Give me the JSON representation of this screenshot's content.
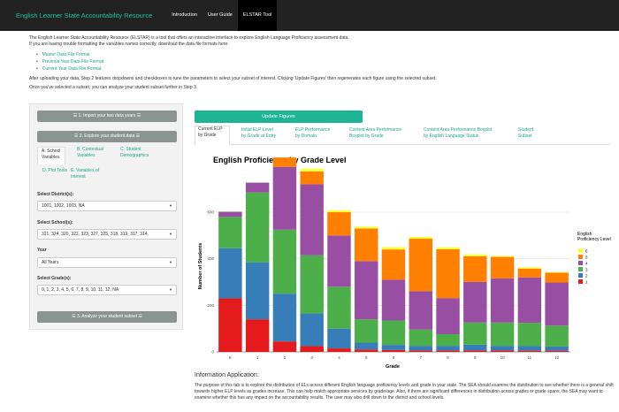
{
  "navbar": {
    "brand": "English Learner State Accountability Resource",
    "items": [
      "Introduction",
      "User Guide",
      "ELSTAR Tool"
    ],
    "active_index": 2
  },
  "intro": {
    "line1": "The English Learner State Accountability Resource (ELSTAR) is a tool that offers an interactive interface to explore English Language Proficiency assessment data.",
    "line2": "If you are having trouble formatting the variables names correctly, download the data file formats here:",
    "links": [
      "Master Data File Format",
      "Previous Year Data File Format",
      "Current Year Data File Format"
    ],
    "line3": "After uploading your data, Step 2 features dropdowns and checkboxes to tune the parameters to select your subset of interest. Clicking 'Update Figures' then regenerates each figure using the selected subset.",
    "line4": "Once you've selected a subset, you can analyze your student subset further in Step 3."
  },
  "sidebar": {
    "step1": "☰ 1. Import your two data years ☰",
    "step2": "☰ 2. Explore your student data ☰",
    "subtabs": [
      "A. School Variables",
      "B. Contextual Variables",
      "C. Student Demographics",
      "D. Plot Tools",
      "E. Variables of Interest"
    ],
    "district_label": "Select District(s):",
    "district_value": "1001, 1002, 1003, NA",
    "school_label": "Select School(s):",
    "school_value": "321, 324, 320, 322, 323, 327, 325, 318, 319, 317, 314,",
    "year_label": "Year",
    "year_value": "All Years",
    "grade_label": "Select Grade(s):",
    "grade_value": "0, 1, 2, 3, 4, 5, 6, 7, 8, 9, 10, 11, 12, NA",
    "step3": "☰ 3. Analyze your student subset ☰"
  },
  "main": {
    "update_button": "Update Figures",
    "tabs": [
      {
        "l1": "Current ELP",
        "l2": "by Grade"
      },
      {
        "l1": "Initial ELP Level",
        "l2": "by Grade at Entry"
      },
      {
        "l1": "ELP Performance",
        "l2": "by Domain"
      },
      {
        "l1": "Content Area Performance",
        "l2": "Boxplot by Grade"
      },
      {
        "l1": "Content Area Performance Boxplot",
        "l2": "by English Language Status"
      },
      {
        "l1": "Student",
        "l2": "Subset"
      }
    ],
    "info_title": "Information Application:",
    "info_text": "The purpose of this tab is to explore the distribution of ELs across different English language proficiency levels and grade in your state. The SEA should examine the distribution to see whether there is a general shift towards higher ELP levels as grades increase. This can help match appropriate services by grade/age. Also, if there are significant differences in distribution across grades or grade spans, the SEA may want to examine whether this has any impact on the accountability results. The user may also drill down to the district and school levels."
  },
  "chart_data": {
    "type": "bar",
    "stacked": true,
    "title": "English Proficiency by Grade Level",
    "xlabel": "Grade",
    "ylabel": "Number of Students",
    "legend_title": "English Proficiency Level",
    "legend_position": "right",
    "categories": [
      "K",
      "1",
      "2",
      "3",
      "4",
      "5",
      "6",
      "7",
      "8",
      "9",
      "10",
      "11",
      "12"
    ],
    "yticks": [
      0,
      200,
      400,
      600
    ],
    "ylim": [
      0,
      790
    ],
    "grid": true,
    "series": [
      {
        "name": "1",
        "color": "#e41a1c",
        "values": [
          230,
          140,
          45,
          25,
          15,
          10,
          8,
          6,
          6,
          6,
          6,
          5,
          5
        ]
      },
      {
        "name": "2",
        "color": "#377eb8",
        "values": [
          215,
          245,
          205,
          140,
          85,
          30,
          22,
          20,
          20,
          25,
          20,
          20,
          18
        ]
      },
      {
        "name": "3",
        "color": "#4daf4a",
        "values": [
          135,
          300,
          275,
          250,
          180,
          100,
          105,
          70,
          50,
          95,
          100,
          100,
          90
        ]
      },
      {
        "name": "4",
        "color": "#984ea3",
        "values": [
          22,
          42,
          270,
          305,
          220,
          250,
          175,
          165,
          155,
          175,
          190,
          195,
          185
        ]
      },
      {
        "name": "5",
        "color": "#ff7f00",
        "values": [
          0,
          0,
          40,
          55,
          100,
          140,
          130,
          225,
          210,
          110,
          92,
          38,
          42
        ]
      },
      {
        "name": "6",
        "color": "#ffff33",
        "values": [
          0,
          0,
          0,
          12,
          8,
          8,
          10,
          8,
          8,
          8,
          4,
          5,
          3
        ]
      }
    ]
  },
  "colors": {
    "navbar": "#222222",
    "brand": "#20c0a0",
    "accent": "#1cb495",
    "sidebar_button": "#8a9592"
  }
}
